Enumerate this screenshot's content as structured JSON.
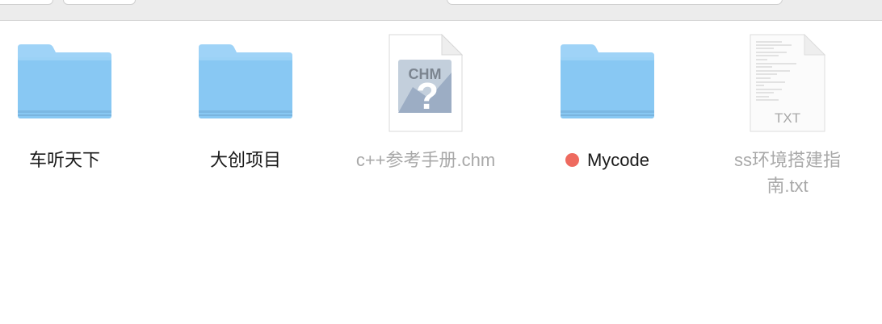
{
  "items": [
    {
      "label": "车听天下",
      "type": "folder"
    },
    {
      "label": "大创项目",
      "type": "folder"
    },
    {
      "label": "c++参考手册.chm",
      "type": "chm-file",
      "badge": "CHM",
      "dimmed": true
    },
    {
      "label": "Mycode",
      "type": "folder",
      "tag_color": "#ee6a5f"
    },
    {
      "label_line1": "ss环境搭建指",
      "label_line2": "南.txt",
      "type": "txt-file",
      "badge": "TXT",
      "dimmed": true
    }
  ],
  "colors": {
    "folder_top": "#9dd2f6",
    "folder_body": "#86c8f4",
    "dim_label": "#a9a9a9"
  }
}
